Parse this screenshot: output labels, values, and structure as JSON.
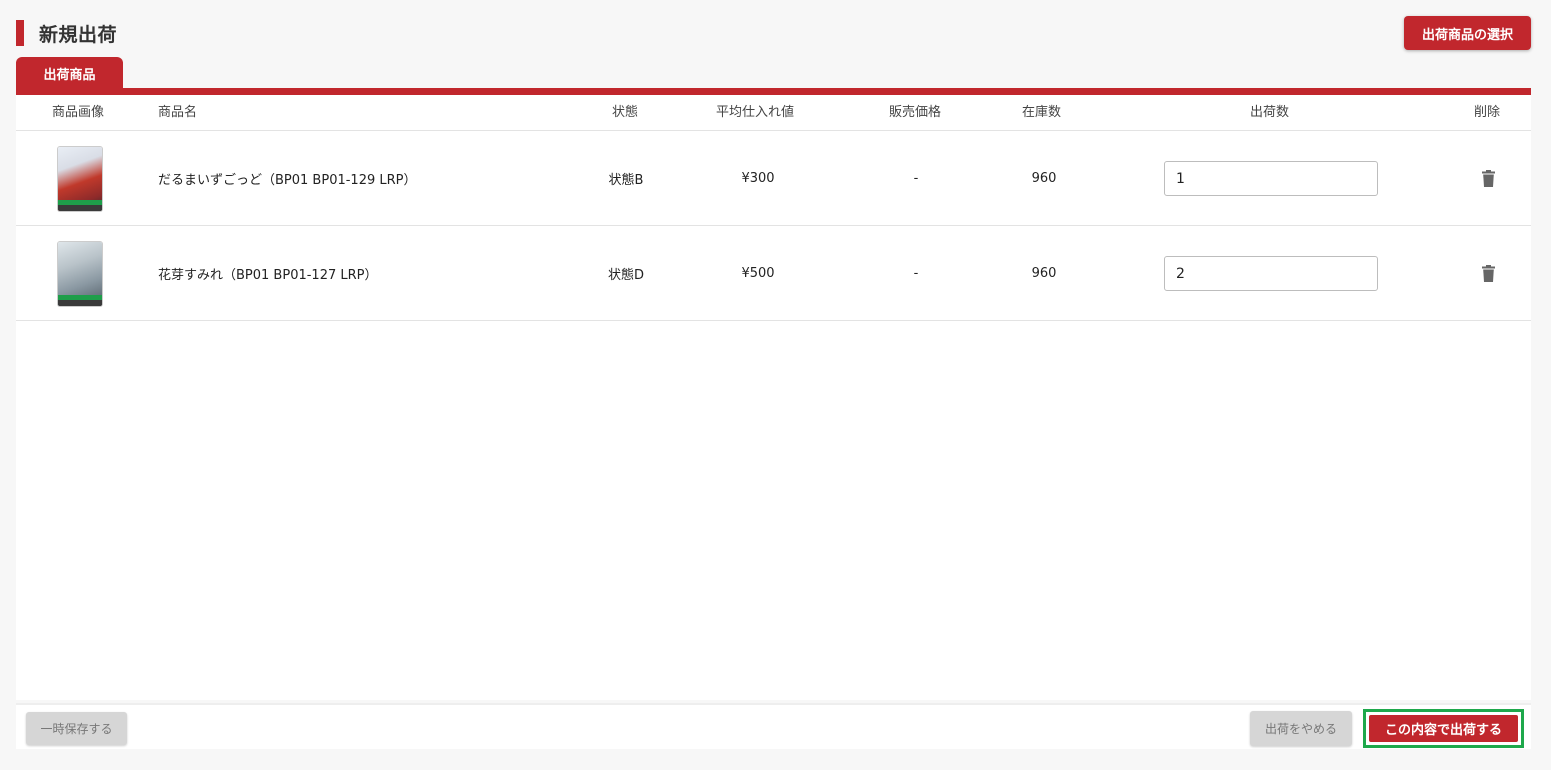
{
  "header": {
    "title": "新規出荷",
    "select_button": "出荷商品の選択"
  },
  "tabs": [
    {
      "label": "出荷商品"
    }
  ],
  "table": {
    "columns": [
      "商品画像",
      "商品名",
      "状態",
      "平均仕入れ値",
      "販売価格",
      "在庫数",
      "出荷数",
      "削除"
    ],
    "rows": [
      {
        "name": "だるまいずごっど（BP01 BP01-129 LRP）",
        "condition": "状態B",
        "avg_cost": "¥300",
        "price": "-",
        "stock": "960",
        "quantity": "1"
      },
      {
        "name": "花芽すみれ（BP01 BP01-127 LRP）",
        "condition": "状態D",
        "avg_cost": "¥500",
        "price": "-",
        "stock": "960",
        "quantity": "2"
      }
    ]
  },
  "footer": {
    "save_draft": "一時保存する",
    "cancel": "出荷をやめる",
    "submit": "この内容で出荷する"
  },
  "colors": {
    "accent": "#c1272d",
    "highlight": "#1ea84b"
  },
  "icons": {
    "delete": "trash-icon"
  }
}
